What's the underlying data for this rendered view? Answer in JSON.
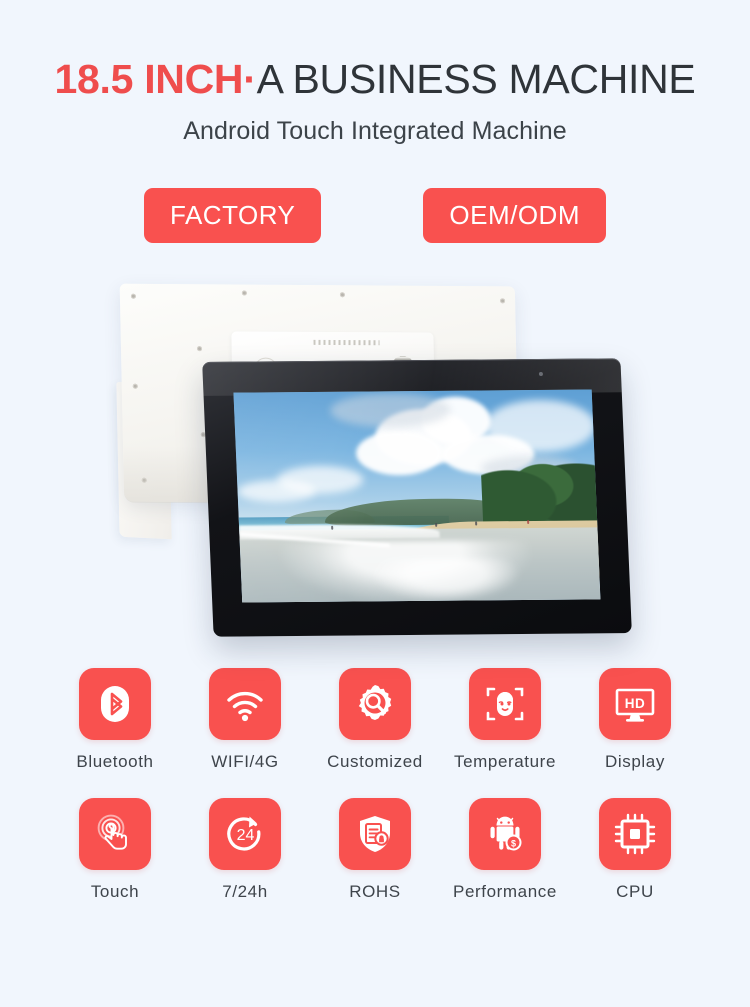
{
  "header": {
    "headline_accent": "18.5 INCH·",
    "headline_rest": "A BUSINESS MACHINE",
    "subtitle": "Android Touch Integrated Machine"
  },
  "badges": [
    {
      "label": "FACTORY",
      "name": "factory-badge"
    },
    {
      "label": "OEM/ODM",
      "name": "oem-odm-badge"
    }
  ],
  "hero": {
    "alt": "18.5 inch Android touch integrated machine, rear white housing and front black tablet displaying a beach scene",
    "screen_content": "beach-photo"
  },
  "features": [
    {
      "label": "Bluetooth",
      "icon": "bluetooth-icon"
    },
    {
      "label": "WIFI/4G",
      "icon": "wifi-icon"
    },
    {
      "label": "Customized",
      "icon": "gear-search-icon"
    },
    {
      "label": "Temperature",
      "icon": "face-scan-icon"
    },
    {
      "label": "Display",
      "icon": "hd-monitor-icon"
    },
    {
      "label": "Touch",
      "icon": "touch-hand-icon"
    },
    {
      "label": "7/24h",
      "icon": "clock-24-icon"
    },
    {
      "label": "ROHS",
      "icon": "shield-document-icon"
    },
    {
      "label": "Performance",
      "icon": "android-robot-icon"
    },
    {
      "label": "CPU",
      "icon": "cpu-chip-icon"
    }
  ],
  "colors": {
    "background": "#f1f6fd",
    "accent_red": "#f9514f",
    "headline_red": "#ef4d4d",
    "text_dark": "#2f3439",
    "label_gray": "#3e444b"
  }
}
